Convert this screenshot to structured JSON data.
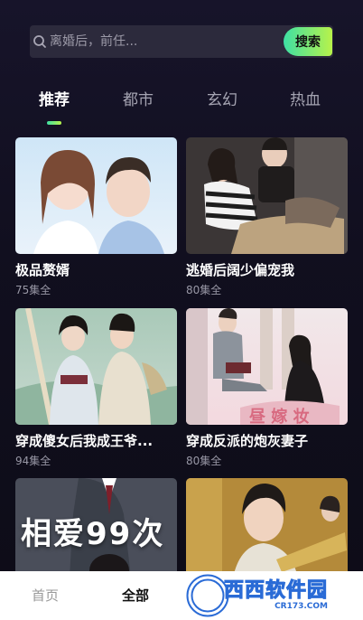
{
  "search": {
    "placeholder": "离婚后，前任...",
    "button_label": "搜索"
  },
  "tabs": [
    {
      "label": "推荐",
      "active": true
    },
    {
      "label": "都市",
      "active": false
    },
    {
      "label": "玄幻",
      "active": false
    },
    {
      "label": "热血",
      "active": false
    }
  ],
  "dramas": [
    {
      "title": "极品赘婿",
      "count": "75集全"
    },
    {
      "title": "逃婚后阔少偏宠我",
      "count": "80集全"
    },
    {
      "title": "穿成傻女后我成王爷...",
      "count": "94集全"
    },
    {
      "title": "穿成反派的炮灰妻子",
      "count": "80集全"
    },
    {
      "title": "",
      "count": "",
      "poster_text": "相爱99次"
    },
    {
      "title": "",
      "count": ""
    }
  ],
  "bottom_nav": {
    "items": [
      {
        "label": "首页",
        "active": false
      },
      {
        "label": "全部",
        "active": true
      }
    ]
  },
  "watermark": {
    "brand": "西西软件园",
    "url": "CR173.COM"
  },
  "colors": {
    "accent_start": "#3ee0a4",
    "accent_end": "#b8f24a",
    "background": "#110f1f"
  }
}
